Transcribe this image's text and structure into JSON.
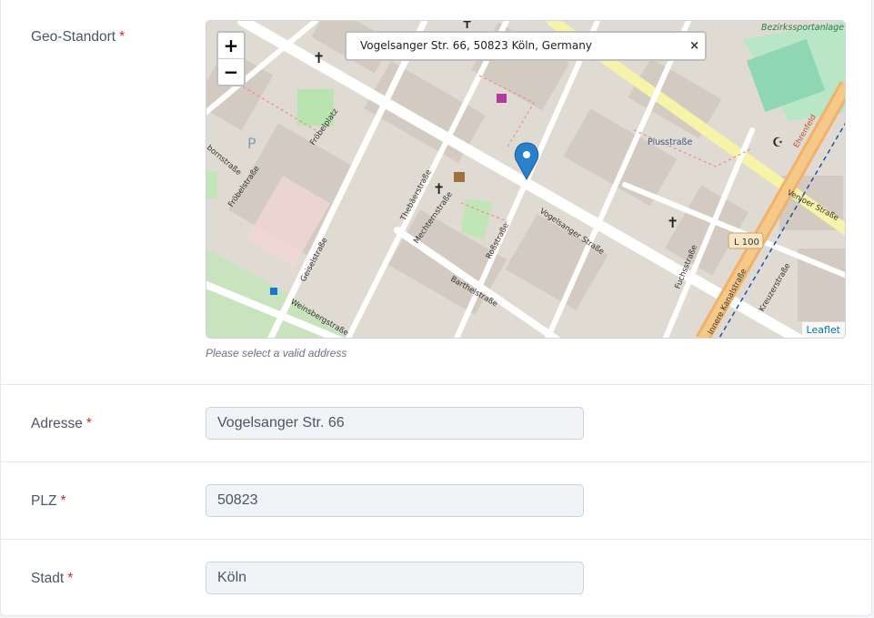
{
  "geo": {
    "label": "Geo-Standort",
    "required_mark": "*",
    "search_value": "Vogelsanger Str. 66, 50823 Köln, Germany",
    "clear_label": "×",
    "zoom_in": "+",
    "zoom_out": "−",
    "attribution": "Leaflet",
    "hint": "Please select a valid address",
    "street_labels": [
      "Vogelsanger Straße",
      "Piusstraße",
      "Venloer Straße",
      "Fuchsstraße",
      "Innere Kanalstraße",
      "Barthelstraße",
      "Roßstraße",
      "Mechternstraße",
      "Thebäerstraße",
      "Geiselstraße",
      "Fröbelstraße",
      "Fröbelplatz",
      "Weinsbergstraße",
      "Kreuzerstraße",
      "Bezirkssportanlage Mitte",
      "L 100",
      "bornstraße",
      "Ehrenfeld"
    ]
  },
  "fields": [
    {
      "label": "Adresse",
      "required_mark": "*",
      "value": "Vogelsanger Str. 66"
    },
    {
      "label": "PLZ",
      "required_mark": "*",
      "value": "50823"
    },
    {
      "label": "Stadt",
      "required_mark": "*",
      "value": "Köln"
    }
  ]
}
